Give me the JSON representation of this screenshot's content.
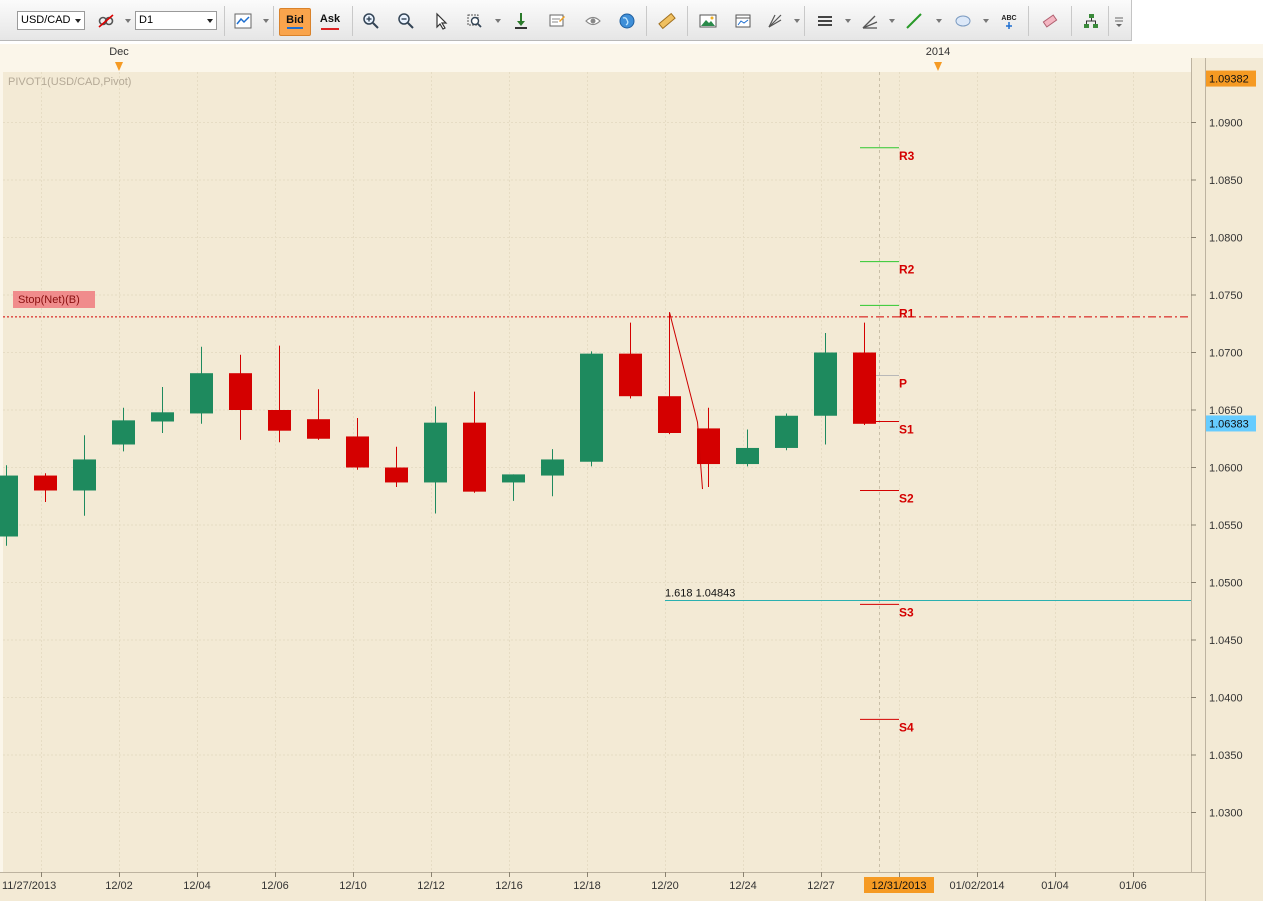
{
  "toolbar": {
    "symbol": "USD/CAD",
    "timeframe": "D1",
    "bid_label": "Bid",
    "ask_label": "Ask",
    "text_tool_label": "ABC"
  },
  "chart": {
    "indicator_label": "PIVOT1(USD/CAD,Pivot)",
    "stop_order_label": "Stop(Net)(B)",
    "current_price": "1.06383",
    "top_price": "1.09382",
    "fib_label": "1.618 1.04843",
    "month_markers": [
      "Dec",
      "2014"
    ],
    "date_labels": [
      "11/27/2013",
      "12/02",
      "12/04",
      "12/06",
      "12/10",
      "12/12",
      "12/16",
      "12/18",
      "12/20",
      "12/24",
      "12/27",
      "12/31/2013",
      "01/02/2014",
      "01/04",
      "01/06"
    ],
    "price_labels": [
      "1.0900",
      "1.0850",
      "1.0800",
      "1.0750",
      "1.0700",
      "1.0650",
      "1.0600",
      "1.0550",
      "1.0500",
      "1.0450",
      "1.0400",
      "1.0350",
      "1.0300"
    ],
    "colors": {
      "up": "#1e8a5e",
      "down": "#d40000",
      "background": "#f3ead5",
      "fib": "#2ab0b0",
      "stop": "#f08c8c",
      "current": "#66ccff",
      "top": "#f59a23"
    }
  },
  "chart_data": {
    "type": "candlestick",
    "symbol": "USD/CAD",
    "timeframe": "D1",
    "ylim": [
      1.025,
      1.095
    ],
    "candles": [
      {
        "o": 1.054,
        "h": 1.0602,
        "l": 1.0532,
        "c": 1.0593
      },
      {
        "o": 1.0593,
        "h": 1.0595,
        "l": 1.057,
        "c": 1.058
      },
      {
        "o": 1.058,
        "h": 1.0628,
        "l": 1.0558,
        "c": 1.0607
      },
      {
        "o": 1.062,
        "h": 1.0652,
        "l": 1.0614,
        "c": 1.0641
      },
      {
        "o": 1.064,
        "h": 1.067,
        "l": 1.063,
        "c": 1.0648
      },
      {
        "o": 1.0647,
        "h": 1.0705,
        "l": 1.0638,
        "c": 1.0682
      },
      {
        "o": 1.0682,
        "h": 1.0698,
        "l": 1.0624,
        "c": 1.065
      },
      {
        "o": 1.065,
        "h": 1.0706,
        "l": 1.0622,
        "c": 1.0632
      },
      {
        "o": 1.0642,
        "h": 1.0668,
        "l": 1.0624,
        "c": 1.0625
      },
      {
        "o": 1.0627,
        "h": 1.0643,
        "l": 1.0598,
        "c": 1.06
      },
      {
        "o": 1.06,
        "h": 1.0618,
        "l": 1.0583,
        "c": 1.0587
      },
      {
        "o": 1.0587,
        "h": 1.0653,
        "l": 1.056,
        "c": 1.0639
      },
      {
        "o": 1.0639,
        "h": 1.0666,
        "l": 1.0578,
        "c": 1.0579
      },
      {
        "o": 1.0587,
        "h": 1.0594,
        "l": 1.0571,
        "c": 1.0594
      },
      {
        "o": 1.0593,
        "h": 1.0616,
        "l": 1.0575,
        "c": 1.0607
      },
      {
        "o": 1.0605,
        "h": 1.0701,
        "l": 1.0601,
        "c": 1.0699
      },
      {
        "o": 1.0699,
        "h": 1.0726,
        "l": 1.066,
        "c": 1.0662
      },
      {
        "o": 1.0662,
        "h": 1.0735,
        "l": 1.0629,
        "c": 1.063
      },
      {
        "o": 1.0634,
        "h": 1.0652,
        "l": 1.0583,
        "c": 1.0603
      },
      {
        "o": 1.0603,
        "h": 1.0633,
        "l": 1.0601,
        "c": 1.0617
      },
      {
        "o": 1.0617,
        "h": 1.0647,
        "l": 1.0615,
        "c": 1.0645
      },
      {
        "o": 1.0645,
        "h": 1.0717,
        "l": 1.062,
        "c": 1.07
      },
      {
        "o": 1.07,
        "h": 1.0726,
        "l": 1.0637,
        "c": 1.0638
      }
    ],
    "pivots": [
      {
        "name": "R3",
        "value": 1.0878
      },
      {
        "name": "R2",
        "value": 1.0779
      },
      {
        "name": "R1",
        "value": 1.0741
      },
      {
        "name": "P",
        "value": 1.068
      },
      {
        "name": "S1",
        "value": 1.064
      },
      {
        "name": "S2",
        "value": 1.058
      },
      {
        "name": "S3",
        "value": 1.0481
      },
      {
        "name": "S4",
        "value": 1.0381
      }
    ],
    "stop_level": 1.0731,
    "fib_level": 1.04843,
    "current_price": 1.06383,
    "top_price": 1.09382,
    "fib_drawing": {
      "x": [
        17,
        18
      ],
      "y": [
        1.0735,
        1.0583
      ]
    }
  }
}
